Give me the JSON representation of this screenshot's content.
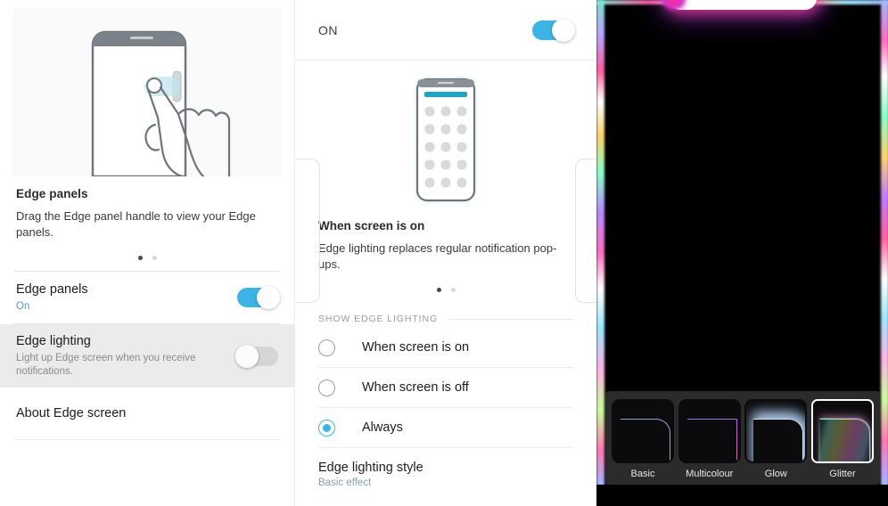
{
  "panel_left": {
    "illustration": "hand-dragging-edge-panel-handle-illustration",
    "card": {
      "title": "Edge panels",
      "description": "Drag the Edge panel handle to view your Edge panels.",
      "dots": [
        {
          "active": true
        },
        {
          "active": false
        }
      ]
    },
    "rows": [
      {
        "title": "Edge panels",
        "subtitle": "On",
        "toggle": "on"
      },
      {
        "title": "Edge lighting",
        "subtitle": "Light up Edge screen when you receive notifications.",
        "toggle": "off"
      },
      {
        "title": "About Edge screen",
        "subtitle": "",
        "toggle": "none"
      }
    ]
  },
  "panel_mid": {
    "topbar": {
      "label": "ON",
      "toggle": "on"
    },
    "illustration": "phone-with-app-grid-and-notification-bar-illustration",
    "card": {
      "title": "When screen is on",
      "description": "Edge lighting replaces regular notification pop-ups.",
      "dots": [
        {
          "active": true
        },
        {
          "active": false
        }
      ]
    },
    "section_header": "SHOW EDGE LIGHTING",
    "radio_options": [
      {
        "label": "When screen is on",
        "checked": false
      },
      {
        "label": "When screen is off",
        "checked": false
      },
      {
        "label": "Always",
        "checked": true
      }
    ],
    "style_setting": {
      "title": "Edge lighting style",
      "subtitle": "Basic effect"
    }
  },
  "panel_right": {
    "preview": {
      "notification": "white-notification-pill",
      "edge_effect": "glitter-iridescent-edge-glow"
    },
    "style_picker": [
      {
        "label": "Basic",
        "selected": false
      },
      {
        "label": "Multicolour",
        "selected": false
      },
      {
        "label": "Glow",
        "selected": false
      },
      {
        "label": "Glitter",
        "selected": true
      }
    ]
  },
  "colors": {
    "accent_blue": "#3cb4e5",
    "accent_teal_text": "#5b9bb0",
    "highlight_row": "#ebebeb",
    "dark_bg": "#000000",
    "picker_bg": "#2b2b2b"
  }
}
